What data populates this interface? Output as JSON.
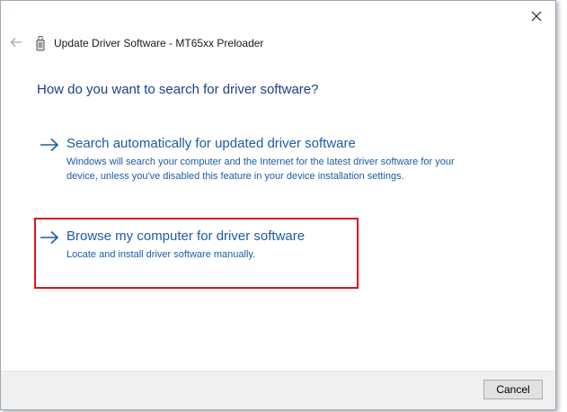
{
  "window": {
    "close_icon": "close-icon"
  },
  "header": {
    "back_icon": "back-arrow-icon",
    "device_icon": "usb-device-icon",
    "title": "Update Driver Software - MT65xx Preloader"
  },
  "main": {
    "question": "How do you want to search for driver software?",
    "options": [
      {
        "title": "Search automatically for updated driver software",
        "description": "Windows will search your computer and the Internet for the latest driver software for your device, unless you've disabled this feature in your device installation settings.",
        "icon": "right-arrow-icon"
      },
      {
        "title": "Browse my computer for driver software",
        "description": "Locate and install driver software manually.",
        "icon": "right-arrow-icon",
        "highlighted": true
      }
    ]
  },
  "footer": {
    "cancel_label": "Cancel"
  },
  "colors": {
    "link_blue": "#1e5ba8",
    "heading_blue": "#1e3f8a",
    "highlight_red": "#e0111b",
    "footer_bg": "#f0f0f0"
  }
}
